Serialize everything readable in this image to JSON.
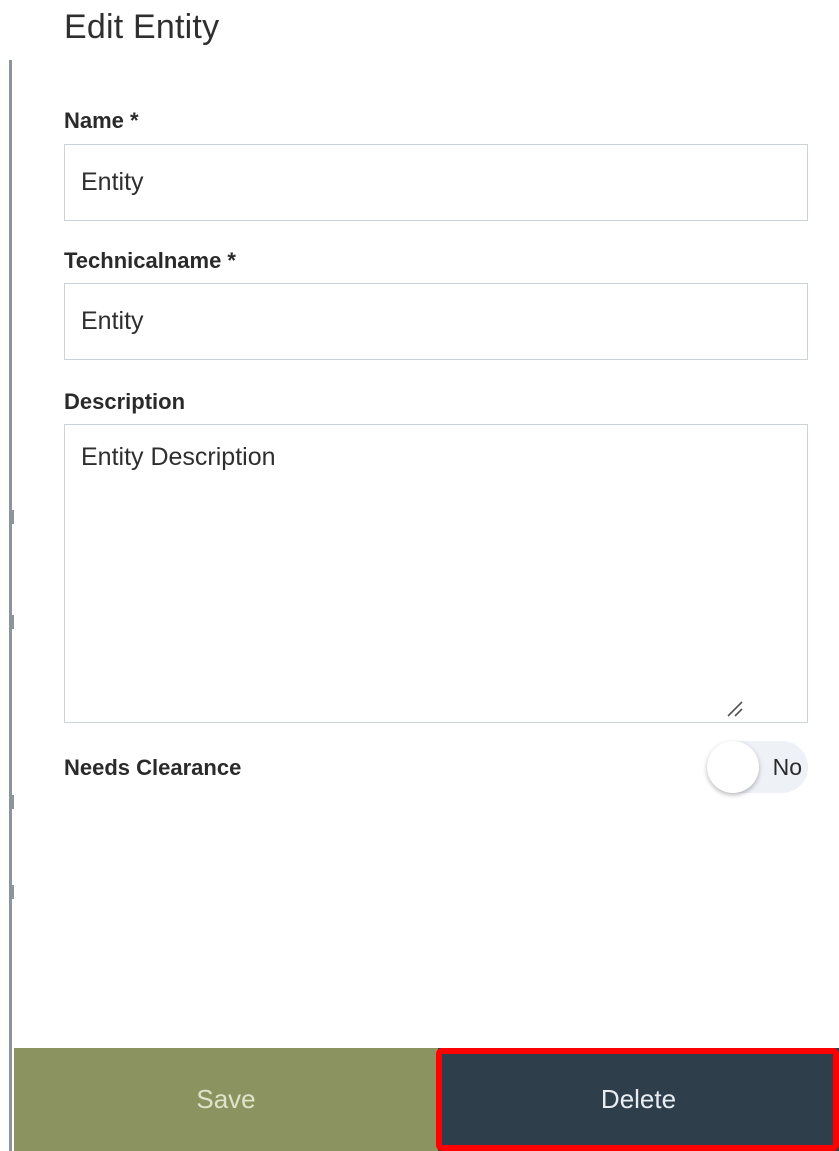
{
  "dialog": {
    "title": "Edit Entity"
  },
  "form": {
    "name": {
      "label": "Name *",
      "value": "Entity"
    },
    "technicalname": {
      "label": "Technicalname *",
      "value": "Entity"
    },
    "description": {
      "label": "Description",
      "value": "Entity Description"
    },
    "needs_clearance": {
      "label": "Needs Clearance",
      "state_text": "No",
      "checked": false
    }
  },
  "footer": {
    "save_label": "Save",
    "delete_label": "Delete"
  },
  "colors": {
    "save_bg": "#8b9461",
    "delete_bg": "#2f3e4b",
    "highlight": "#ff0000"
  },
  "icons": {
    "resize": "resize-grip-icon"
  }
}
